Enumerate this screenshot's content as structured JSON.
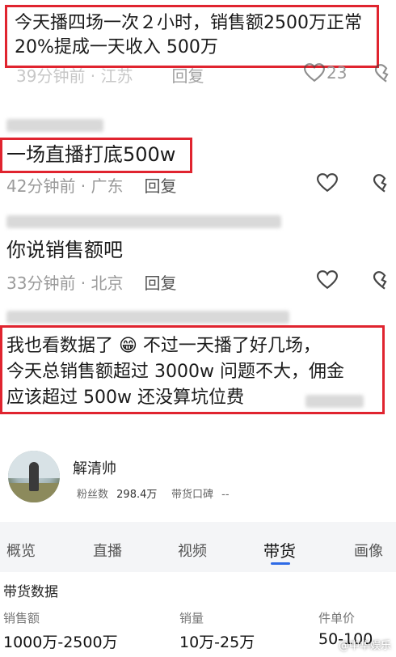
{
  "comments": [
    {
      "text_lines": [
        "今天播四场一次２小时，销售额2500万正常",
        "20%提成一天收入 500万"
      ],
      "time": "39分钟前 · 江苏",
      "reply_label": "回复",
      "likes": "23"
    },
    {
      "text_lines": [
        "一场直播打底500w"
      ],
      "time": "42分钟前 · 广东",
      "reply_label": "回复"
    },
    {
      "text_lines": [
        "你说销售额吧"
      ],
      "time": "33分钟前 · 北京",
      "reply_label": "回复"
    },
    {
      "text_lines": [
        "我也看数据了 😁 不过一天播了好几场，",
        "今天总销售额超过 3000w 问题不大，佣金",
        "应该超过 500w 还没算坑位费"
      ]
    }
  ],
  "profile": {
    "name": "解清帅",
    "fans_label": "粉丝数",
    "fans_value": "298.4万",
    "reputation_label": "带货口碑",
    "reputation_value": "--"
  },
  "tabs": [
    {
      "label": "概览"
    },
    {
      "label": "直播"
    },
    {
      "label": "视频"
    },
    {
      "label": "带货",
      "active": true
    },
    {
      "label": "画像"
    }
  ],
  "sales_section": {
    "title": "带货数据",
    "metrics": [
      {
        "label": "销售额",
        "value": "1000万-2500万"
      },
      {
        "label": "销量",
        "value": "10万-25万"
      },
      {
        "label": "件单价",
        "value": "50-100"
      }
    ]
  },
  "watermark": "@中华娱乐",
  "colors": {
    "highlight": "#e0242f",
    "accent": "#2e6ae6"
  },
  "icons": [
    "heart-icon",
    "dislike-icon"
  ]
}
